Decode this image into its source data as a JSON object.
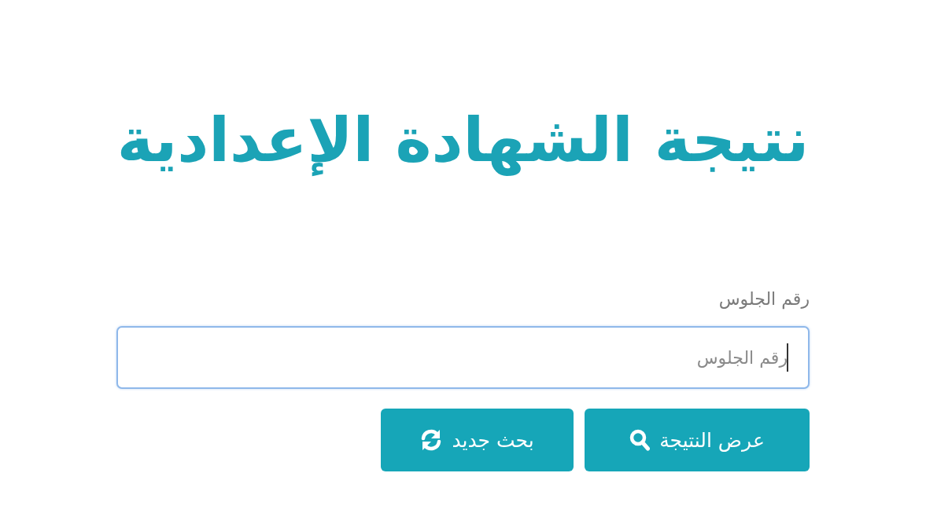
{
  "title": "نتيجة الشهادة الإعدادية",
  "form": {
    "label": "رقم الجلوس",
    "field": {
      "placeholder": "رقم الجلوس",
      "focused": true
    },
    "buttons": [
      {
        "label": "عرض النتيجة",
        "kind": "submit"
      },
      {
        "label": "بحث جديد",
        "kind": "reset"
      }
    ]
  }
}
